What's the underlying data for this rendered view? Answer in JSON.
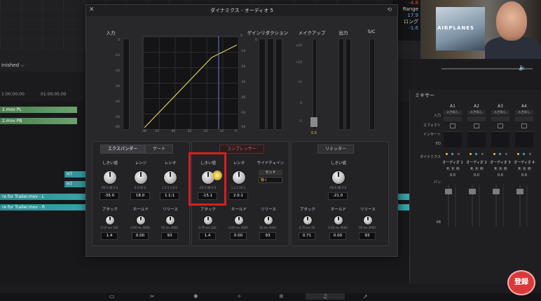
{
  "plugin": {
    "title": "ダイナミクス - オーディオ 5",
    "sections": {
      "input": "入力",
      "gain_reduction": "ゲインリダクション",
      "makeup": "メイクアップ",
      "output": "出力",
      "sc": "S/C"
    },
    "input_scale": [
      "0",
      "-10",
      "-20",
      "-30",
      "-40",
      "-50",
      "-60"
    ],
    "gr_top": "0",
    "makeup_scale": [
      "+20",
      "+10",
      "+5",
      "0",
      "-5",
      "-10"
    ],
    "makeup_value": "0.0",
    "graph_x_ticks": [
      "dB",
      "-50",
      "-40",
      "-30",
      "-20",
      "-10",
      "0"
    ],
    "graph_right_ticks": [
      "0",
      "-10",
      "-20",
      "-30",
      "-40",
      "-50",
      "-60"
    ],
    "expander": {
      "tab_expander": "エクスパンダー",
      "tab_gate": "ゲート",
      "threshold_label": "しきい値",
      "range_label": "レンジ",
      "ratio_label": "レシオ",
      "threshold_range": "-60.0 dB 0.0",
      "range_range": "0.0   60.0",
      "ratio_range": "1.1:1  1.6:1",
      "threshold_value": "-35.0",
      "range_value": "18.0",
      "ratio_value": "1.1:1",
      "attack_label": "アタック",
      "hold_label": "ホールド",
      "release_label": "リリース",
      "attack_range": "0.50  ms  100",
      "hold_range": "0.00  ms  4000",
      "release_range": "50  ms  4000",
      "attack_value": "1.4",
      "hold_value": "0.00",
      "release_value": "93"
    },
    "compressor": {
      "tab": "コンプレッサー",
      "threshold_label": "しきい値",
      "ratio_label": "レシオ",
      "sidechain_label": "サイドチェイン",
      "threshold_range": "-60.0 dB 0.0",
      "ratio_range": "1.1:1   20:1",
      "threshold_value": "-15.1",
      "ratio_value": "2.0:1",
      "sidechain_send": "センド",
      "sidechain_listen": "聴く",
      "attack_label": "アタック",
      "hold_label": "ホールド",
      "release_label": "リリース",
      "attack_range": "0.70  ms  100",
      "hold_range": "0.00  ms  4000",
      "release_range": "50  ms  4000",
      "attack_value": "1.4",
      "hold_value": "0.00",
      "release_value": "93"
    },
    "limiter": {
      "tab": "リミッター",
      "threshold_label": "しきい値",
      "threshold_range": "-60.0 dB 0.0",
      "threshold_value": "-21.0",
      "attack_label": "アタック",
      "hold_label": "ホールド",
      "release_label": "リリース",
      "attack_range": "0.70  ms  30",
      "hold_range": "0.00  ms  4000",
      "release_range": "50  ms  4000",
      "attack_value": "0.71",
      "hold_value": "0.00",
      "release_value": "93"
    }
  },
  "background": {
    "meter_readout": [
      "-4.8",
      "Range",
      "17.9",
      "ロング",
      "-1.6"
    ],
    "poster_text": "AIRPLANES",
    "timeline_menu": "inished ⌵",
    "ruler": [
      "1:00:00:00",
      "01:00:05:00"
    ],
    "clips": [
      "2.mov PL",
      "2.mov PB",
      "H7",
      "H7",
      "re for Trailer.mov - L",
      "re for Trailer.mov - R"
    ],
    "sub_badge": "登録"
  },
  "mixer": {
    "title": "ミキサー",
    "row_labels": [
      "入力",
      "エフェクト",
      "インサート",
      "EQ",
      "ダイナミクス",
      "パン"
    ],
    "channels": [
      {
        "id": "A1",
        "input": "入力なし",
        "name": "オーディオ 1",
        "value": "0.0"
      },
      {
        "id": "A2",
        "input": "入力なし",
        "name": "オーディオ 2",
        "value": "0.0"
      },
      {
        "id": "A3",
        "input": "入力なし",
        "name": "オーディオ 3",
        "value": "0.0"
      },
      {
        "id": "A4",
        "input": "入力なし",
        "name": "オーディオ 4",
        "value": "0.0"
      }
    ],
    "db_label": "dB"
  }
}
